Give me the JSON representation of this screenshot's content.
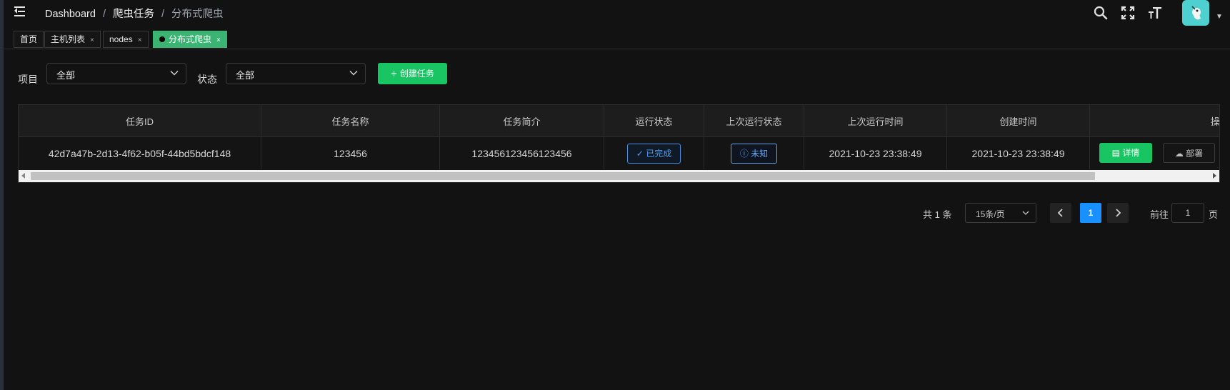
{
  "navbar": {
    "breadcrumb": [
      "Dashboard",
      "爬虫任务",
      "分布式爬虫"
    ],
    "separator": "/"
  },
  "tags": [
    {
      "label": "首页",
      "closable": false,
      "active": false
    },
    {
      "label": "主机列表",
      "closable": true,
      "active": false
    },
    {
      "label": "nodes",
      "closable": true,
      "active": false
    },
    {
      "label": "分布式爬虫",
      "closable": true,
      "active": true
    }
  ],
  "tag_close": "×",
  "filters": {
    "project_label": "项目",
    "project_value": "全部",
    "status_label": "状态",
    "status_value": "全部",
    "create_button": "创建任务",
    "create_plus": "+"
  },
  "table": {
    "headers": [
      "任务ID",
      "任务名称",
      "任务简介",
      "运行状态",
      "上次运行状态",
      "上次运行时间",
      "创建时间",
      "操"
    ],
    "rows": [
      {
        "id": "42d7a47b-2d13-4f62-b05f-44bd5bdcf148",
        "name": "123456",
        "desc": "123456123456123456",
        "run_status": "已完成",
        "last_status": "未知",
        "last_run_time": "2021-10-23 23:38:49",
        "created_time": "2021-10-23 23:38:49",
        "detail_button": "详情",
        "deploy_button": "部署"
      }
    ]
  },
  "pagination": {
    "total": "共 1 条",
    "page_size": "15条/页",
    "current_page": "1",
    "goto_label": "前往",
    "goto_value": "1",
    "page_suffix": "页"
  },
  "colors": {
    "background": "#121212",
    "accent_green": "#19c463",
    "active_tag": "#3bb372",
    "primary_blue": "#1890ff",
    "avatar": "#4fd0d0"
  }
}
